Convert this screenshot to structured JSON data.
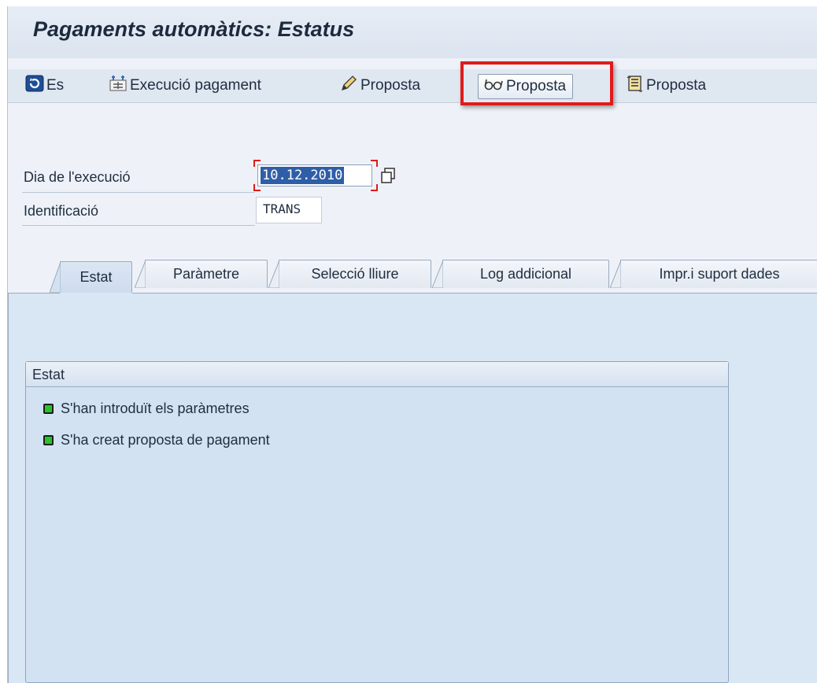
{
  "window": {
    "title": "Pagaments automàtics: Estatus"
  },
  "toolbar": {
    "items": [
      {
        "label": "Es",
        "icon": "refresh-icon"
      },
      {
        "label": "Execució pagament",
        "icon": "schedule-run-icon"
      },
      {
        "label": "Proposta",
        "icon": "pencil-icon"
      },
      {
        "label": "Proposta",
        "icon": "glasses-icon",
        "highlighted": true
      },
      {
        "label": "Proposta",
        "icon": "scroll-list-icon"
      }
    ]
  },
  "form": {
    "run_date_label": "Dia de l'execució",
    "run_date_value": "10.12.2010",
    "identification_label": "Identificació",
    "identification_value": "TRANS"
  },
  "tabs": [
    {
      "label": "Estat",
      "active": true
    },
    {
      "label": "Paràmetre",
      "active": false
    },
    {
      "label": "Selecció lliure",
      "active": false
    },
    {
      "label": "Log addicional",
      "active": false
    },
    {
      "label": "Impr.i suport dades",
      "active": false
    }
  ],
  "status_group": {
    "title": "Estat",
    "items": [
      {
        "text": "S'han introduït els paràmetres",
        "status": "green"
      },
      {
        "text": "S'ha creat proposta de pagament",
        "status": "green"
      }
    ]
  },
  "colors": {
    "highlight": "#e01b1b",
    "status_green": "#28c428",
    "selection": "#2f5ea8"
  }
}
